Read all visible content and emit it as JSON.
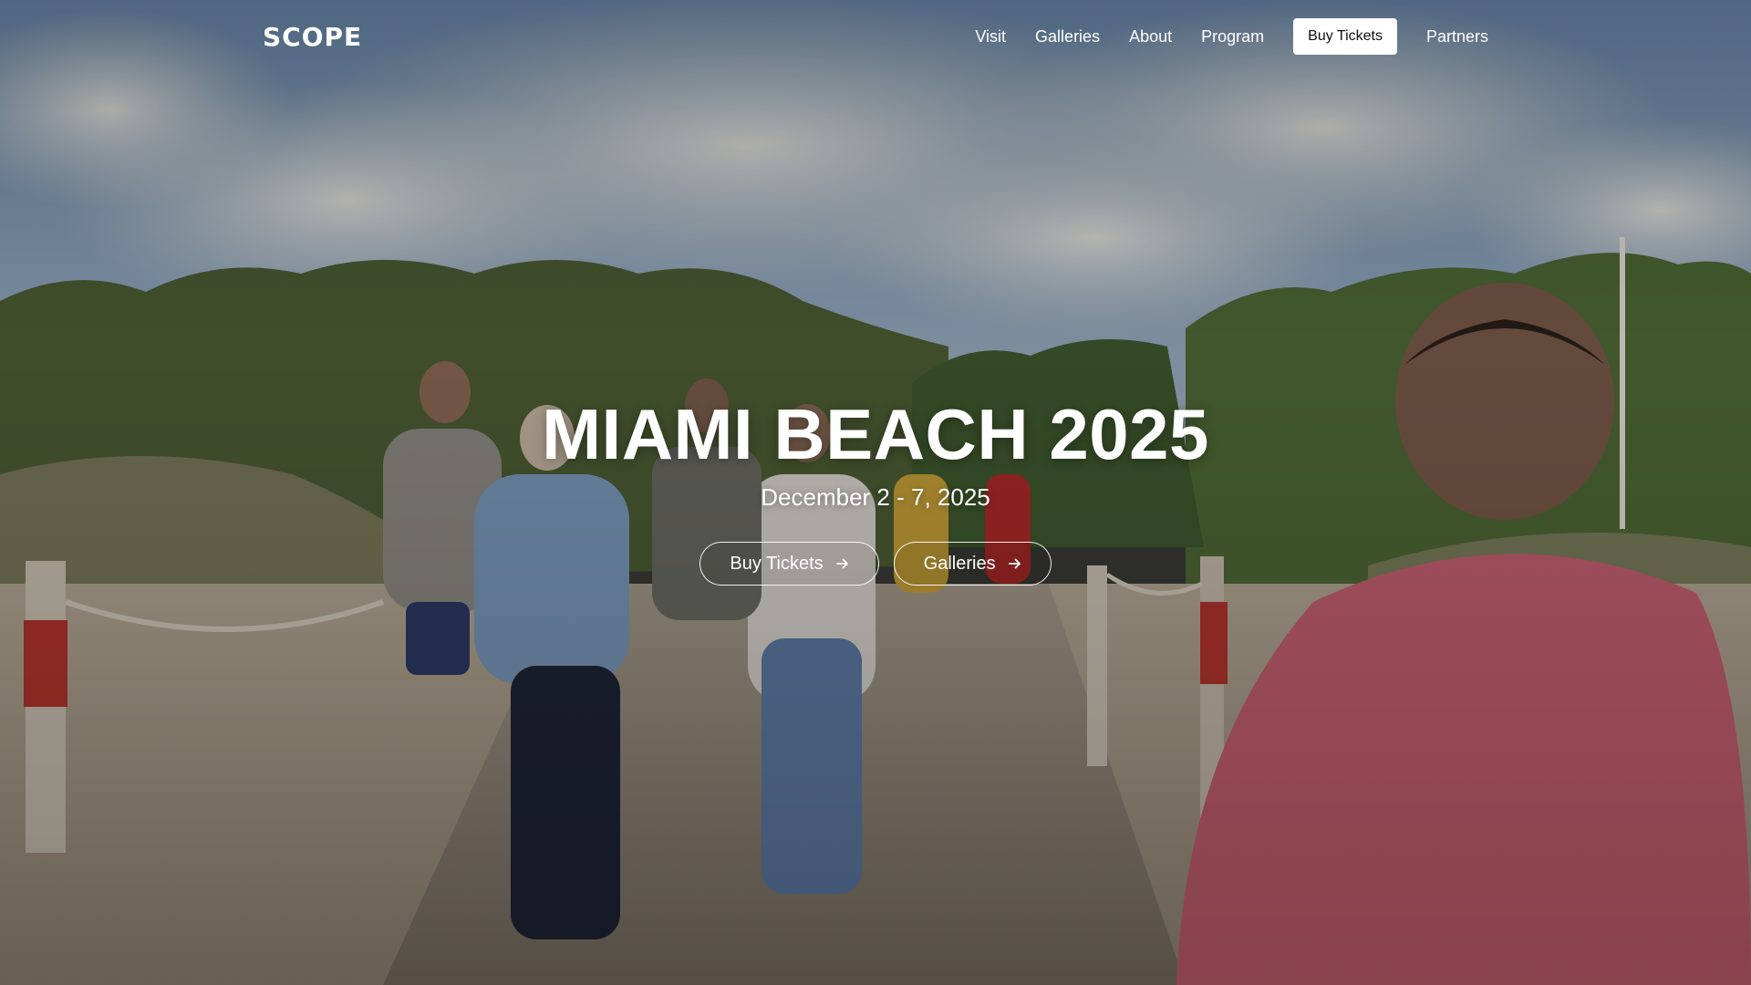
{
  "brand": {
    "logo_text": "SCOPE"
  },
  "nav": {
    "links": [
      {
        "label": "Visit"
      },
      {
        "label": "Galleries"
      },
      {
        "label": "About"
      },
      {
        "label": "Program"
      }
    ],
    "cta_label": "Buy Tickets",
    "partners_label": "Partners"
  },
  "hero": {
    "title": "MIAMI BEACH 2025",
    "date": "December 2 - 7, 2025",
    "buttons": [
      {
        "label": "Buy Tickets",
        "icon": "arrow-right-icon"
      },
      {
        "label": "Galleries",
        "icon": "arrow-right-icon"
      }
    ],
    "background_image": "beach-boardwalk-crowd-photo"
  },
  "colors": {
    "text": "#ffffff",
    "cta_bg": "#ffffff",
    "cta_text": "#111111"
  }
}
